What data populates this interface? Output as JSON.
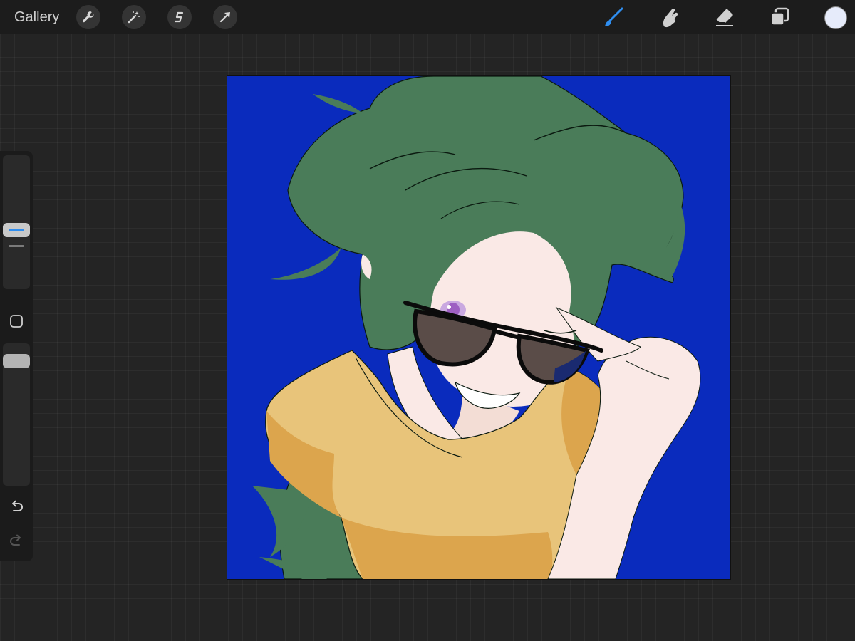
{
  "topbar": {
    "gallery_label": "Gallery",
    "left_tools": [
      "wrench-icon",
      "magic-wand-icon",
      "selection-icon",
      "transform-arrow-icon"
    ],
    "right_tools": [
      "brush-icon",
      "smudge-icon",
      "eraser-icon",
      "layers-icon"
    ],
    "active_tool": "brush-icon",
    "current_color": "#e6ebfa"
  },
  "sidebar": {
    "brush_size_level": 0.5,
    "opacity_level": 0.95,
    "icons": [
      "modify-square-icon",
      "undo-icon",
      "redo-icon"
    ]
  },
  "canvas": {
    "background_color": "#0a2bbd",
    "hair_color": "#4a7c59",
    "shirt_color": "#e8c47a",
    "skin_color": "#fae9e6",
    "lens_color": "#5a4c48"
  }
}
